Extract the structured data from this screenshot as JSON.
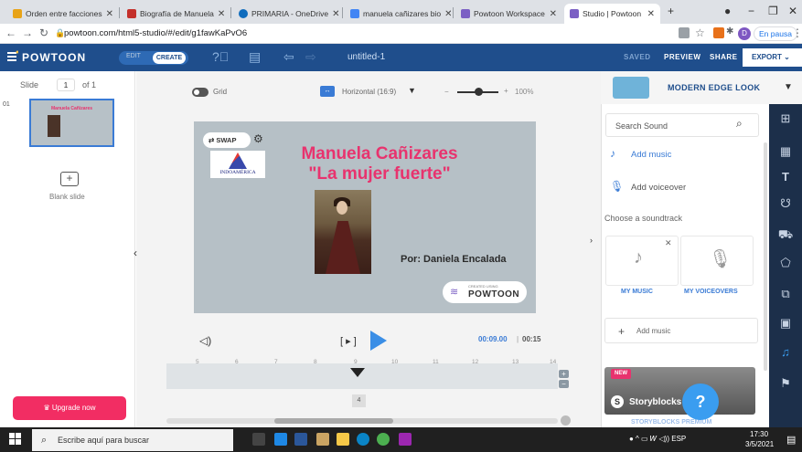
{
  "browser": {
    "tabs": [
      {
        "title": "Orden entre facciones",
        "fav": "#e8a317"
      },
      {
        "title": "Biografía de Manuela",
        "fav": "#c4302b"
      },
      {
        "title": "PRIMARIA - OneDrive",
        "fav": "#0f6cbd"
      },
      {
        "title": "manuela cañizares bio",
        "fav": "#4285f4"
      },
      {
        "title": "Powtoon Workspace",
        "fav": "#7b5fc4"
      },
      {
        "title": "Studio | Powtoon",
        "fav": "#7b5fc4"
      }
    ],
    "url": "powtoon.com/html5-studio/#/edit/g1fawKaPvO6",
    "profile_initial": "D",
    "pause_label": "En pausa"
  },
  "header": {
    "logo": "POWTOON",
    "mode_edit": "EDIT",
    "mode_create": "CREATE",
    "title": "untitled-1",
    "saved": "SAVED",
    "preview": "PREVIEW",
    "share": "SHARE",
    "export": "EXPORT"
  },
  "left_panel": {
    "slide_label": "Slide",
    "slide_num": "1",
    "slide_of": "of 1",
    "thumb_index": "01",
    "thumb_title": "Manuela Cañizares",
    "blank_slide": "Blank slide",
    "upgrade": "Upgrade now"
  },
  "canvas": {
    "grid_label": "Grid",
    "aspect_label": "Horizontal (16:9)",
    "zoom": "100%",
    "swap": "SWAP",
    "uni_name": "INDOAMÉRICA",
    "title_line1": "Manuela Cañizares",
    "title_line2": "\"La mujer fuerte\"",
    "author": "Por: Daniela Encalada",
    "created_small": "CREATED USING",
    "created_big": "POWTOON"
  },
  "playback": {
    "bracket": "[ ▸ ]",
    "time_current": "00:09.00",
    "time_separator": "|",
    "time_total": "00:15",
    "ticks": [
      "5",
      "6",
      "7",
      "8",
      "9",
      "10",
      "11",
      "12",
      "13",
      "14"
    ],
    "scene_index": "4"
  },
  "sound_panel": {
    "look_title": "MODERN EDGE LOOK",
    "search_placeholder": "Search Sound",
    "add_music": "Add music",
    "add_voiceover": "Add voiceover",
    "choose_soundtrack": "Choose a soundtrack",
    "my_music": "MY MUSIC",
    "my_voiceovers": "MY VOICEOVERS",
    "add_music_2": "Add music",
    "new_badge": "NEW",
    "storyblocks": "Storyblocks",
    "storyblocks_premium": "STORYBLOCKS PREMIUM",
    "help": "?"
  },
  "rail_icons": [
    "layout-icon",
    "background-icon",
    "text-icon",
    "characters-icon",
    "props-icon",
    "shapes-icon",
    "media-icon",
    "video-icon",
    "sound-icon",
    "specials-icon"
  ],
  "taskbar": {
    "search": "Escribe aquí para buscar",
    "lang": "ESP",
    "time": "17:30",
    "date": "3/5/2021"
  }
}
